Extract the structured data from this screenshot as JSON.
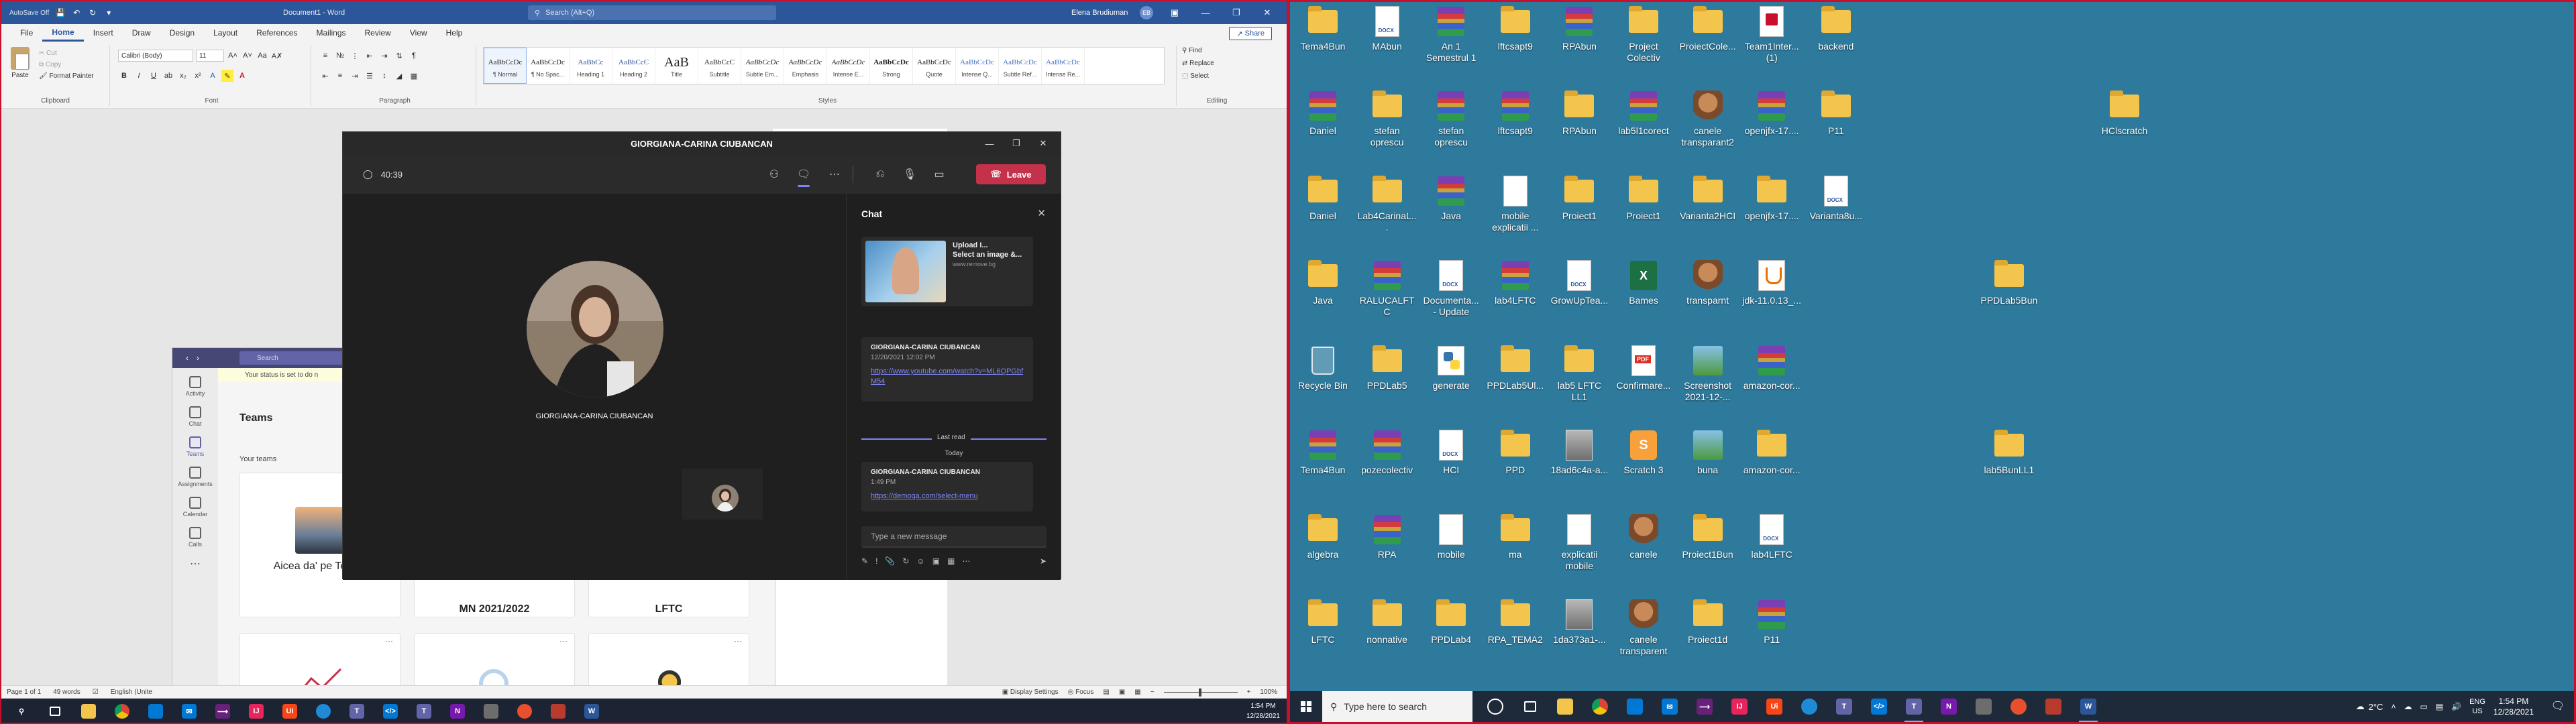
{
  "word": {
    "autosave_label": "AutoSave",
    "autosave_state": "Off",
    "title": "Document1 - Word",
    "search_placeholder": "Search (Alt+Q)",
    "user_name": "Elena Brudiuman",
    "user_initials": "EB",
    "tabs": [
      "File",
      "Home",
      "Insert",
      "Draw",
      "Design",
      "Layout",
      "References",
      "Mailings",
      "Review",
      "View",
      "Help"
    ],
    "active_tab": "Home",
    "share_label": "Share",
    "clipboard": {
      "paste": "Paste",
      "cut": "Cut",
      "copy": "Copy",
      "format_painter": "Format Painter",
      "group": "Clipboard"
    },
    "font": {
      "family": "Calibri (Body)",
      "size": "11",
      "group": "Font"
    },
    "paragraph_group": "Paragraph",
    "styles": [
      {
        "sample": "AaBbCcDc",
        "name": "¶ Normal"
      },
      {
        "sample": "AaBbCcDc",
        "name": "¶ No Spac..."
      },
      {
        "sample": "AaBbCc",
        "name": "Heading 1"
      },
      {
        "sample": "AaBbCcC",
        "name": "Heading 2"
      },
      {
        "sample": "AaB",
        "name": "Title"
      },
      {
        "sample": "AaBbCcC",
        "name": "Subtitle"
      },
      {
        "sample": "AaBbCcDc",
        "name": "Subtle Em..."
      },
      {
        "sample": "AaBbCcDc",
        "name": "Emphasis"
      },
      {
        "sample": "AaBbCcDc",
        "name": "Intense E..."
      },
      {
        "sample": "AaBbCcDc",
        "name": "Strong"
      },
      {
        "sample": "AaBbCcDc",
        "name": "Quote"
      },
      {
        "sample": "AaBbCcDc",
        "name": "Intense Q..."
      },
      {
        "sample": "AaBbCcDc",
        "name": "Subtle Ref..."
      },
      {
        "sample": "AaBbCcDc",
        "name": "Intense Re..."
      }
    ],
    "styles_group": "Styles",
    "editing": {
      "find": "Find",
      "replace": "Replace",
      "select": "Select",
      "group": "Editing"
    },
    "status": {
      "page": "Page 1 of 1",
      "words": "49 words",
      "language": "English (Unite",
      "display_settings": "Display Settings",
      "focus": "Focus",
      "zoom": "100%"
    }
  },
  "left_taskbar": {
    "time": "1:54 PM",
    "date": "12/28/2021"
  },
  "teams_main": {
    "search_placeholder": "Search",
    "status_message": "Your status is set to do n",
    "rail": [
      "Activity",
      "Chat",
      "Teams",
      "Assignments",
      "Calendar",
      "Calls"
    ],
    "active_rail": "Teams",
    "heading": "Teams",
    "your_teams": "Your teams",
    "cards": [
      {
        "name": "Aicea da' pe Teams"
      },
      {
        "name": "MN 2021/2022"
      },
      {
        "name": "LFTC"
      }
    ]
  },
  "call": {
    "title": "GIORGIANA-CARINA CIUBANCAN",
    "timer": "40:39",
    "leave_label": "Leave",
    "callee_name": "GIORGIANA-CARINA CIUBANCAN"
  },
  "chat": {
    "title": "Chat",
    "upload_title": "Upload I...",
    "upload_body": "Select an image &...",
    "upload_source": "www.remove.bg",
    "messages": [
      {
        "sender": "GIORGIANA-CARINA CIUBANCAN",
        "time": "12/20/2021 12:02 PM",
        "link": "https://www.youtube.com/watch?v=ML6QPGbfM54"
      },
      {
        "sender": "GIORGIANA-CARINA CIUBANCAN",
        "time": "1:49 PM",
        "link": "https://demoqa.com/select-menu"
      }
    ],
    "last_read": "Last read",
    "today": "Today",
    "input_placeholder": "Type a new message"
  },
  "desktop_icons": [
    {
      "label": "Tema4Bun",
      "type": "folder",
      "col": 0,
      "row": 0
    },
    {
      "label": "MAbun",
      "type": "doc",
      "col": 1,
      "row": 0
    },
    {
      "label": "An 1 Semestrul 1",
      "type": "rar",
      "col": 2,
      "row": 0
    },
    {
      "label": "lftcsapt9",
      "type": "folder",
      "col": 3,
      "row": 0
    },
    {
      "label": "RPAbun",
      "type": "rar",
      "col": 4,
      "row": 0
    },
    {
      "label": "Project Colectiv",
      "type": "folder",
      "col": 5,
      "row": 0
    },
    {
      "label": "ProiectColе...",
      "type": "folder",
      "col": 6,
      "row": 0
    },
    {
      "label": "Team1Inter... (1)",
      "type": "shortcut",
      "col": 7,
      "row": 0
    },
    {
      "label": "backend",
      "type": "folder",
      "col": 8,
      "row": 0
    },
    {
      "label": "Daniel",
      "type": "rar",
      "col": 0,
      "row": 1
    },
    {
      "label": "stefan oprescu",
      "type": "folder",
      "col": 1,
      "row": 1
    },
    {
      "label": "stefan oprescu",
      "type": "rar",
      "col": 2,
      "row": 1
    },
    {
      "label": "lftcsapt9",
      "type": "rar",
      "col": 3,
      "row": 1
    },
    {
      "label": "RPAbun",
      "type": "folder",
      "col": 4,
      "row": 1
    },
    {
      "label": "lab5l1corect",
      "type": "rar",
      "col": 5,
      "row": 1
    },
    {
      "label": "canele transparant2",
      "type": "dog",
      "col": 6,
      "row": 1
    },
    {
      "label": "openjfx-17....",
      "type": "rar",
      "col": 7,
      "row": 1
    },
    {
      "label": "P11",
      "type": "folder",
      "col": 8,
      "row": 1
    },
    {
      "label": "HClscratch",
      "type": "folder",
      "col": 12.5,
      "row": 1
    },
    {
      "label": "Daniel",
      "type": "folder",
      "col": 0,
      "row": 2
    },
    {
      "label": "Lab4CarinaL...",
      "type": "folder",
      "col": 1,
      "row": 2
    },
    {
      "label": "Java",
      "type": "rar",
      "col": 2,
      "row": 2
    },
    {
      "label": "mobile explicatii ...",
      "type": "mobile",
      "col": 3,
      "row": 2
    },
    {
      "label": "Proiect1",
      "type": "folder",
      "col": 4,
      "row": 2
    },
    {
      "label": "Proiect1",
      "type": "folder",
      "col": 5,
      "row": 2
    },
    {
      "label": "Varianta2HCI",
      "type": "folder",
      "col": 6,
      "row": 2
    },
    {
      "label": "openjfx-17....",
      "type": "folder",
      "col": 7,
      "row": 2
    },
    {
      "label": "Varianta8u...",
      "type": "doc",
      "col": 8,
      "row": 2
    },
    {
      "label": "Java",
      "type": "folder",
      "col": 0,
      "row": 3
    },
    {
      "label": "RALUCALFTC",
      "type": "rar",
      "col": 1,
      "row": 3
    },
    {
      "label": "Documenta... - Update",
      "type": "doc",
      "col": 2,
      "row": 3
    },
    {
      "label": "lab4LFTC",
      "type": "rar",
      "col": 3,
      "row": 3
    },
    {
      "label": "GrowUpTea...",
      "type": "doc",
      "col": 4,
      "row": 3
    },
    {
      "label": "Bames",
      "type": "xls",
      "col": 5,
      "row": 3
    },
    {
      "label": "transparnt",
      "type": "dog",
      "col": 6,
      "row": 3
    },
    {
      "label": "jdk-11.0.13_...",
      "type": "java",
      "col": 7,
      "row": 3
    },
    {
      "label": "PPDLab5Bun",
      "type": "folder",
      "col": 10.7,
      "row": 3
    },
    {
      "label": "Recycle Bin",
      "type": "bin",
      "col": 0,
      "row": 4
    },
    {
      "label": "PPDLab5",
      "type": "folder",
      "col": 1,
      "row": 4
    },
    {
      "label": "generate",
      "type": "python",
      "col": 2,
      "row": 4
    },
    {
      "label": "PPDLab5Ul...",
      "type": "folder",
      "col": 3,
      "row": 4
    },
    {
      "label": "lab5 LFTC LL1",
      "type": "folder",
      "col": 4,
      "row": 4
    },
    {
      "label": "Confirmare...",
      "type": "pdf",
      "col": 5,
      "row": 4
    },
    {
      "label": "Screenshot 2021-12-...",
      "type": "img",
      "col": 6,
      "row": 4
    },
    {
      "label": "amazon-cor...",
      "type": "rar",
      "col": 7,
      "row": 4
    },
    {
      "label": "Tema4Bun",
      "type": "rar",
      "col": 0,
      "row": 5
    },
    {
      "label": "pozecolectiv",
      "type": "rar",
      "col": 1,
      "row": 5
    },
    {
      "label": "HCI",
      "type": "doc",
      "col": 2,
      "row": 5
    },
    {
      "label": "PPD",
      "type": "folder",
      "col": 3,
      "row": 5
    },
    {
      "label": "18ad6c4a-a...",
      "type": "photo",
      "col": 4,
      "row": 5
    },
    {
      "label": "Scratch 3",
      "type": "scratch",
      "col": 5,
      "row": 5
    },
    {
      "label": "buna",
      "type": "img",
      "col": 6,
      "row": 5
    },
    {
      "label": "amazon-cor...",
      "type": "folder",
      "col": 7,
      "row": 5
    },
    {
      "label": "lab5BunLL1",
      "type": "folder",
      "col": 10.7,
      "row": 5
    },
    {
      "label": "algebra",
      "type": "folder",
      "col": 0,
      "row": 6
    },
    {
      "label": "RPA",
      "type": "rar",
      "col": 1,
      "row": 6
    },
    {
      "label": "mobile",
      "type": "mobile",
      "col": 2,
      "row": 6
    },
    {
      "label": "ma",
      "type": "folder",
      "col": 3,
      "row": 6
    },
    {
      "label": "explicatii mobile",
      "type": "mobile",
      "col": 4,
      "row": 6
    },
    {
      "label": "canele",
      "type": "dog",
      "col": 5,
      "row": 6
    },
    {
      "label": "Proiect1Bun",
      "type": "folder",
      "col": 6,
      "row": 6
    },
    {
      "label": "lab4LFTC",
      "type": "doc",
      "col": 7,
      "row": 6
    },
    {
      "label": "LFTC",
      "type": "folder",
      "col": 0,
      "row": 7
    },
    {
      "label": "nonnative",
      "type": "folder",
      "col": 1,
      "row": 7
    },
    {
      "label": "PPDLab4",
      "type": "folder",
      "col": 2,
      "row": 7
    },
    {
      "label": "RPA_TEMA2",
      "type": "folder",
      "col": 3,
      "row": 7
    },
    {
      "label": "1da373a1-...",
      "type": "photo",
      "col": 4,
      "row": 7
    },
    {
      "label": "canele transparent",
      "type": "dog",
      "col": 5,
      "row": 7
    },
    {
      "label": "Proiect1d",
      "type": "folder",
      "col": 6,
      "row": 7
    },
    {
      "label": "P11",
      "type": "rar",
      "col": 7,
      "row": 7
    }
  ],
  "right_taskbar": {
    "search_placeholder": "Type here to search",
    "weather": "2°C",
    "lang_top": "ENG",
    "lang_bottom": "US",
    "time": "1:54 PM",
    "date": "12/28/2021"
  }
}
